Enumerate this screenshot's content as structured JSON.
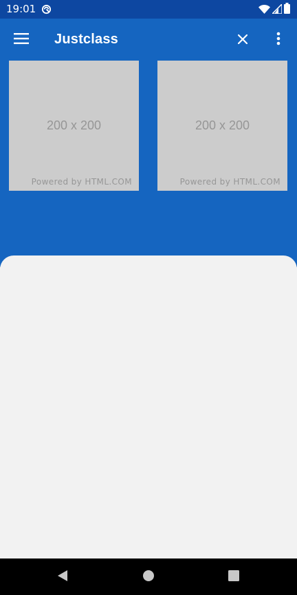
{
  "status_bar": {
    "time": "19:01",
    "icons": [
      "sync-icon",
      "wifi-icon",
      "cellular-signal-icon",
      "battery-icon"
    ]
  },
  "app_bar": {
    "title": "Justclass",
    "icons": [
      "menu-icon",
      "close-icon",
      "more-vert-icon"
    ]
  },
  "images": [
    {
      "size_label": "200 x 200",
      "powered_label": "Powered by HTML.COM"
    },
    {
      "size_label": "200 x 200",
      "powered_label": "Powered by HTML.COM"
    }
  ],
  "nav_bar": {
    "icons": [
      "back-icon",
      "home-icon",
      "recents-icon"
    ]
  },
  "colors": {
    "status_bar": "#0D47A1",
    "app_bar": "#1565C0",
    "sheet": "#F2F2F2",
    "placeholder": "#CCCCCC",
    "placeholder_text": "#969696",
    "nav_bar": "#000000"
  }
}
